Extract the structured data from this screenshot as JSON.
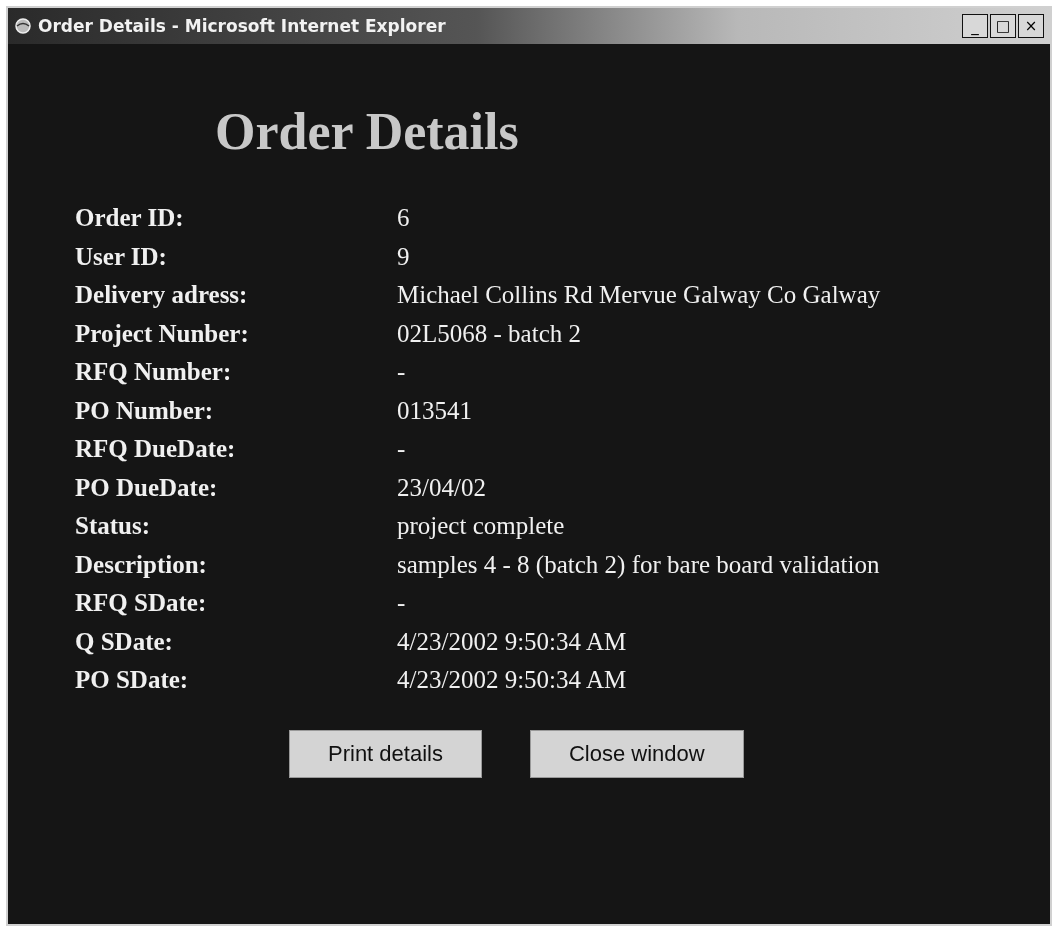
{
  "window": {
    "title": "Order Details - Microsoft Internet Explorer",
    "controls": [
      "_",
      "□",
      "×"
    ]
  },
  "heading": "Order Details",
  "fields": [
    {
      "label": "Order ID:",
      "value": "6"
    },
    {
      "label": "User ID:",
      "value": "9"
    },
    {
      "label": "Delivery adress:",
      "value": "Michael Collins Rd Mervue Galway Co Galway"
    },
    {
      "label": "Project Nunber:",
      "value": "02L5068 - batch 2"
    },
    {
      "label": "RFQ Number:",
      "value": "-"
    },
    {
      "label": "PO Number:",
      "value": "013541"
    },
    {
      "label": "RFQ DueDate:",
      "value": "-"
    },
    {
      "label": "PO DueDate:",
      "value": "23/04/02"
    },
    {
      "label": "Status:",
      "value": "project complete"
    },
    {
      "label": "Description:",
      "value": "samples 4 - 8 (batch 2) for bare board validation"
    },
    {
      "label": "RFQ SDate:",
      "value": "-"
    },
    {
      "label": "Q SDate:",
      "value": "4/23/2002 9:50:34 AM"
    },
    {
      "label": "PO SDate:",
      "value": "4/23/2002 9:50:34 AM"
    }
  ],
  "buttons": [
    "Print details",
    "Close window"
  ]
}
